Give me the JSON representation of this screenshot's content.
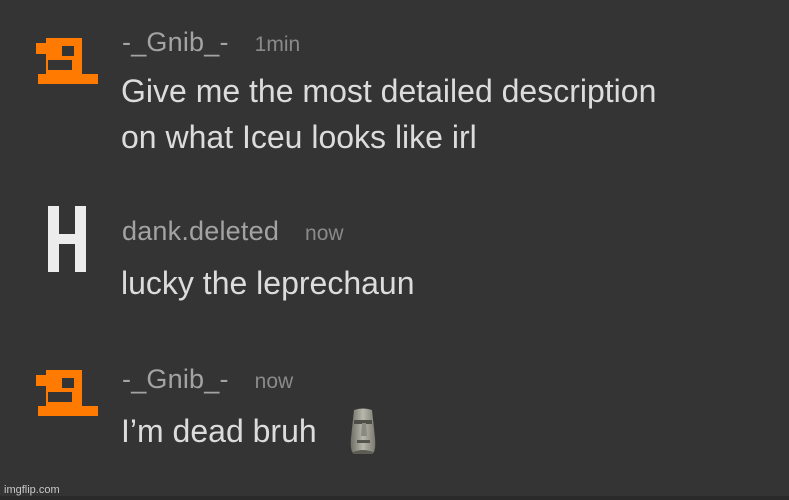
{
  "messages": [
    {
      "username": "-_Gnib_-",
      "timestamp": "1min",
      "lines": [
        "Give me the most detailed description",
        "on what Iceu looks like irl"
      ],
      "avatar_icon": "orange-pixel-avatar-icon",
      "avatar_color": "#ff7a00"
    },
    {
      "username": "dank.deleted",
      "timestamp": "now",
      "lines": [
        "lucky the leprechaun"
      ],
      "avatar_icon": "h-letter-avatar-icon",
      "avatar_color": "#ececec"
    },
    {
      "username": "-_Gnib_-",
      "timestamp": "now",
      "lines": [
        "I’m dead bruh"
      ],
      "avatar_icon": "orange-pixel-avatar-icon",
      "avatar_color": "#ff7a00",
      "emoji_icon": "moai-icon"
    }
  ],
  "watermark": "imgflip.com",
  "colors": {
    "background": "#343434",
    "username": "#a3a3a3",
    "timestamp": "#8a8a8a",
    "text": "#dcdcdc"
  }
}
